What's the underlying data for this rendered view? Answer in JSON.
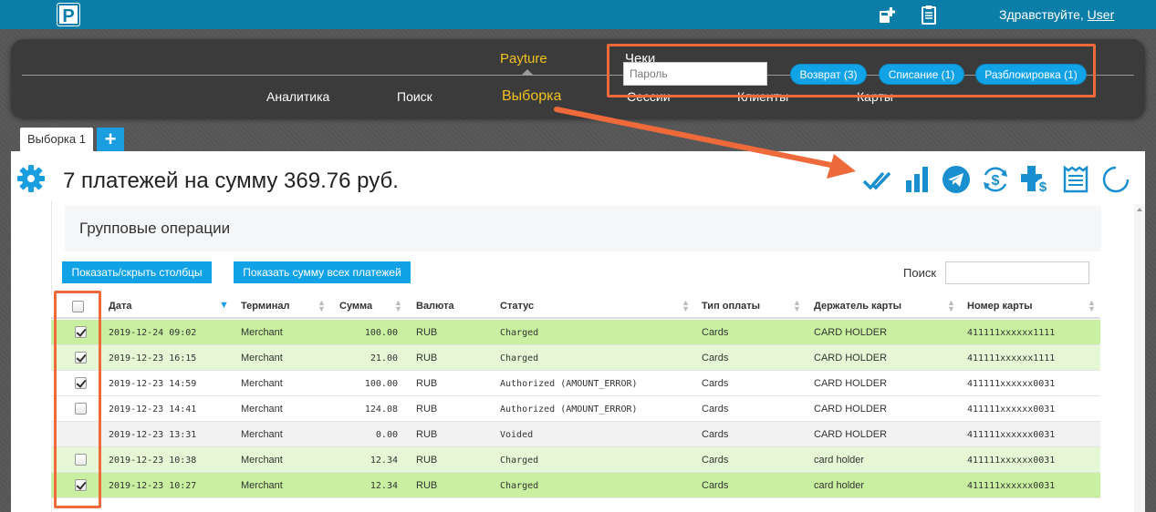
{
  "header": {
    "logo_letter": "P",
    "greeting": "Здравствуйте,",
    "user": "User"
  },
  "nav": {
    "top": [
      {
        "label": "Payture",
        "active": true
      },
      {
        "label": "Чеки",
        "active": false
      }
    ],
    "sub": [
      {
        "label": "Аналитика"
      },
      {
        "label": "Поиск"
      },
      {
        "label": "Выборка",
        "active": true
      },
      {
        "label": "Сессии"
      },
      {
        "label": "Клиенты"
      },
      {
        "label": "Карты"
      }
    ]
  },
  "tabs": {
    "active_label": "Выборка 1",
    "add_label": "+"
  },
  "main": {
    "title": "7 платежей на сумму 369.76 руб."
  },
  "group_ops": {
    "title": "Групповые операции",
    "password_placeholder": "Пароль",
    "refund_label": "Возврат (3)",
    "charge_label": "Списание (1)",
    "unblock_label": "Разблокировка (1)"
  },
  "controls": {
    "toggle_columns_label": "Показать/скрыть столбцы",
    "show_sum_label": "Показать сумму всех платежей",
    "search_label": "Поиск"
  },
  "table": {
    "columns": [
      "Дата",
      "Терминал",
      "Сумма",
      "Валюта",
      "Статус",
      "Тип оплаты",
      "Держатель карты",
      "Номер карты"
    ],
    "rows": [
      {
        "checked": true,
        "has_checkbox": true,
        "highlight": "green",
        "date": "2019-12-24 09:02",
        "terminal": "Merchant",
        "amount": "100.00",
        "currency": "RUB",
        "status": "Charged",
        "pay_type": "Cards",
        "holder": "CARD HOLDER",
        "card": "411111xxxxxx1111"
      },
      {
        "checked": true,
        "has_checkbox": true,
        "highlight": "lightgreen",
        "date": "2019-12-23 16:15",
        "terminal": "Merchant",
        "amount": "21.00",
        "currency": "RUB",
        "status": "Charged",
        "pay_type": "Cards",
        "holder": "CARD HOLDER",
        "card": "411111xxxxxx1111"
      },
      {
        "checked": true,
        "has_checkbox": true,
        "highlight": "none",
        "date": "2019-12-23 14:59",
        "terminal": "Merchant",
        "amount": "100.00",
        "currency": "RUB",
        "status": "Authorized (AMOUNT_ERROR)",
        "pay_type": "Cards",
        "holder": "CARD HOLDER",
        "card": "411111xxxxxx0031"
      },
      {
        "checked": false,
        "has_checkbox": true,
        "highlight": "none",
        "date": "2019-12-23 14:41",
        "terminal": "Merchant",
        "amount": "124.08",
        "currency": "RUB",
        "status": "Authorized (AMOUNT_ERROR)",
        "pay_type": "Cards",
        "holder": "CARD HOLDER",
        "card": "411111xxxxxx0031"
      },
      {
        "checked": false,
        "has_checkbox": false,
        "highlight": "gray",
        "date": "2019-12-23 13:31",
        "terminal": "Merchant",
        "amount": "0.00",
        "currency": "RUB",
        "status": "Voided",
        "pay_type": "Cards",
        "holder": "CARD HOLDER",
        "card": "411111xxxxxx0031"
      },
      {
        "checked": false,
        "has_checkbox": true,
        "highlight": "lightgreen",
        "date": "2019-12-23 10:38",
        "terminal": "Merchant",
        "amount": "12.34",
        "currency": "RUB",
        "status": "Charged",
        "pay_type": "Cards",
        "holder": "card holder",
        "card": "411111xxxxxx0031"
      },
      {
        "checked": true,
        "has_checkbox": true,
        "highlight": "green",
        "date": "2019-12-23 10:27",
        "terminal": "Merchant",
        "amount": "12.34",
        "currency": "RUB",
        "status": "Charged",
        "pay_type": "Cards",
        "holder": "card holder",
        "card": "411111xxxxxx0031"
      }
    ]
  },
  "colors": {
    "topbar": "#0a7ea8",
    "accent": "#12a3e6",
    "nav_active": "#f0c020",
    "row_green": "#c8f0a0",
    "row_lightgreen": "#e6f7d6",
    "row_gray": "#f2f2f2",
    "annotation": "#ee6a3a"
  },
  "icons": [
    "logo-icon",
    "terminal-add-icon",
    "clipboard-icon",
    "gear-icon",
    "double-check-icon",
    "bar-chart-icon",
    "telegram-icon",
    "dollar-cycle-icon",
    "plus-dollar-icon",
    "receipt-icon",
    "refresh-icon"
  ]
}
